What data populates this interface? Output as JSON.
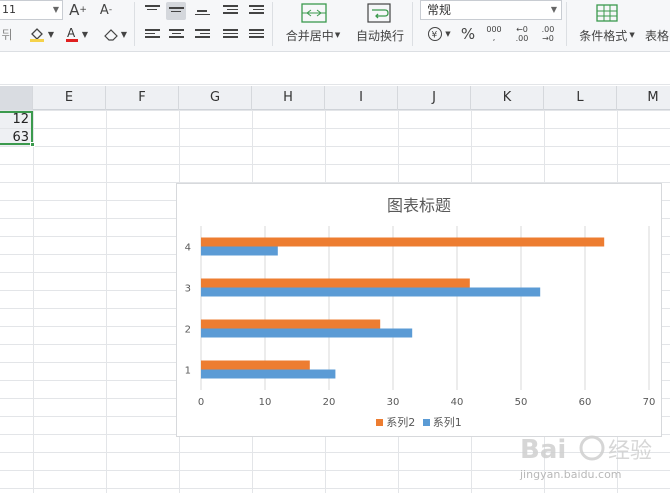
{
  "ribbon": {
    "font_size": "11",
    "grow_font": "A⁺",
    "shrink_font": "A⁻",
    "merge_center": "合并居中",
    "wrap_text": "自动换行",
    "number_format": "常规",
    "percent": "%",
    "thousands": "000",
    "inc_decimal": "+0 .00",
    "dec_decimal": ".00 +0",
    "cond_format": "条件格式",
    "table_style": "表格"
  },
  "columns": [
    "",
    "E",
    "F",
    "G",
    "H",
    "I",
    "J",
    "K",
    "L",
    "M"
  ],
  "cells": {
    "r1": "12",
    "r2": "63"
  },
  "chart_data": {
    "type": "bar",
    "orientation": "horizontal",
    "title": "图表标题",
    "categories": [
      "1",
      "2",
      "3",
      "4"
    ],
    "series": [
      {
        "name": "系列1",
        "values": [
          21,
          33,
          53,
          12
        ],
        "color": "#5b9bd5"
      },
      {
        "name": "系列2",
        "values": [
          17,
          28,
          42,
          63
        ],
        "color": "#ed7d31"
      }
    ],
    "xlim": [
      0,
      70
    ],
    "xticks": [
      "0",
      "10",
      "20",
      "30",
      "40",
      "50",
      "60",
      "70"
    ],
    "grid": true,
    "legend_position": "bottom"
  },
  "watermark": {
    "text": "jingyan.baidu.com"
  },
  "colors": {
    "accent_green": "#3b9a4d",
    "font_red": "#e02020",
    "fill_yellow": "#f5d24b"
  }
}
